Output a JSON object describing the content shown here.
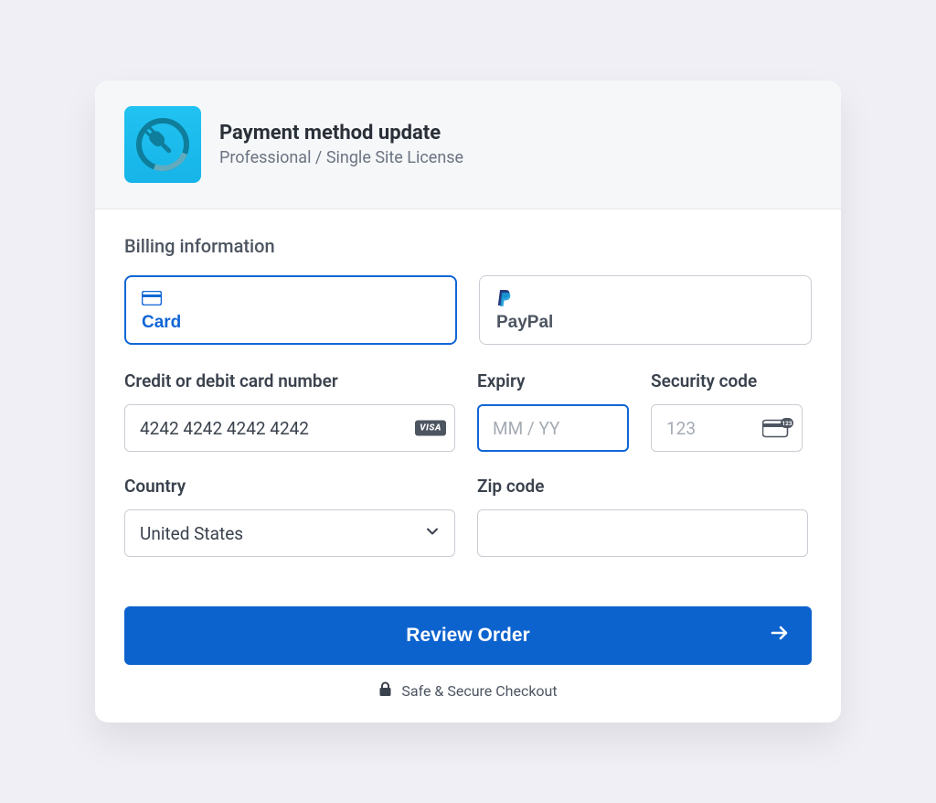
{
  "header": {
    "title": "Payment method update",
    "subtitle": "Professional / Single Site License"
  },
  "billing": {
    "section_title": "Billing information",
    "methods": {
      "card_label": "Card",
      "paypal_label": "PayPal"
    },
    "card_number": {
      "label": "Credit or debit card number",
      "value": "4242 4242 4242 4242",
      "brand_badge": "VISA"
    },
    "expiry": {
      "label": "Expiry",
      "placeholder": "MM / YY",
      "value": ""
    },
    "security": {
      "label": "Security code",
      "placeholder": "123",
      "value": ""
    },
    "country": {
      "label": "Country",
      "value": "United States"
    },
    "zip": {
      "label": "Zip code",
      "value": ""
    }
  },
  "submit_label": "Review Order",
  "secure_text": "Safe & Secure Checkout"
}
